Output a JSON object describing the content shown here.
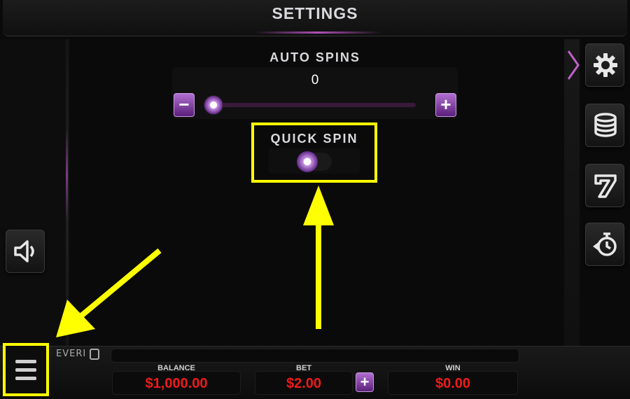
{
  "header": {
    "title": "SETTINGS"
  },
  "auto_spins": {
    "label": "AUTO SPINS",
    "value": "0",
    "minus_label": "−",
    "plus_label": "+",
    "slider_fraction": 0
  },
  "quick_spin": {
    "label": "QUICK SPIN",
    "enabled": false
  },
  "side_buttons": [
    {
      "icon": "gear-icon"
    },
    {
      "icon": "coins-stack-icon"
    },
    {
      "icon": "seven-icon"
    },
    {
      "icon": "timer-icon"
    }
  ],
  "sound_button": {
    "icon": "speaker-icon"
  },
  "bottom_bar": {
    "logo": "EVERI",
    "balance_label": "BALANCE",
    "balance_value": "$1,000.00",
    "bet_label": "BET",
    "bet_value": "$2.00",
    "bet_plus_label": "+",
    "win_label": "WIN",
    "win_value": "$0.00"
  },
  "colors": {
    "highlight": "#ffff00",
    "accent_purple": "#8a3fb0",
    "meter_value": "#ee1a1a"
  }
}
